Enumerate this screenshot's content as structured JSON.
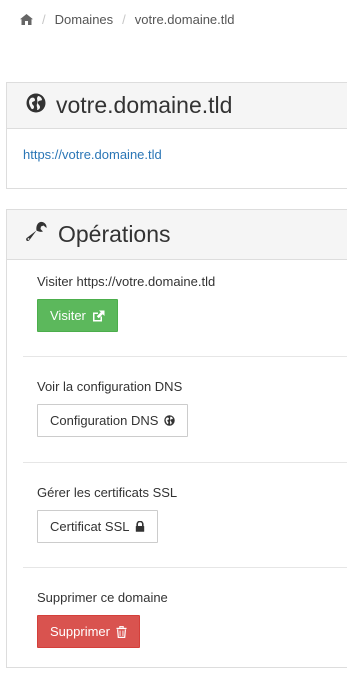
{
  "breadcrumb": {
    "items": [
      {
        "label": "Domaines"
      },
      {
        "label": "votre.domaine.tld"
      }
    ]
  },
  "domain_panel": {
    "title": "votre.domaine.tld",
    "url": "https://votre.domaine.tld"
  },
  "operations_panel": {
    "title": "Opérations",
    "sections": [
      {
        "label": "Visiter https://votre.domaine.tld",
        "button": "Visiter",
        "icon": "external-link-icon",
        "style": "success"
      },
      {
        "label": "Voir la configuration DNS",
        "button": "Configuration DNS",
        "icon": "globe-icon",
        "style": "default"
      },
      {
        "label": "Gérer les certificats SSL",
        "button": "Certificat SSL",
        "icon": "lock-icon",
        "style": "default"
      },
      {
        "label": "Supprimer ce domaine",
        "button": "Supprimer",
        "icon": "trash-icon",
        "style": "danger"
      }
    ]
  },
  "colors": {
    "success": "#5cb85c",
    "danger": "#d9534f",
    "link": "#2a76b6",
    "heading_bg": "#f5f5f5"
  }
}
